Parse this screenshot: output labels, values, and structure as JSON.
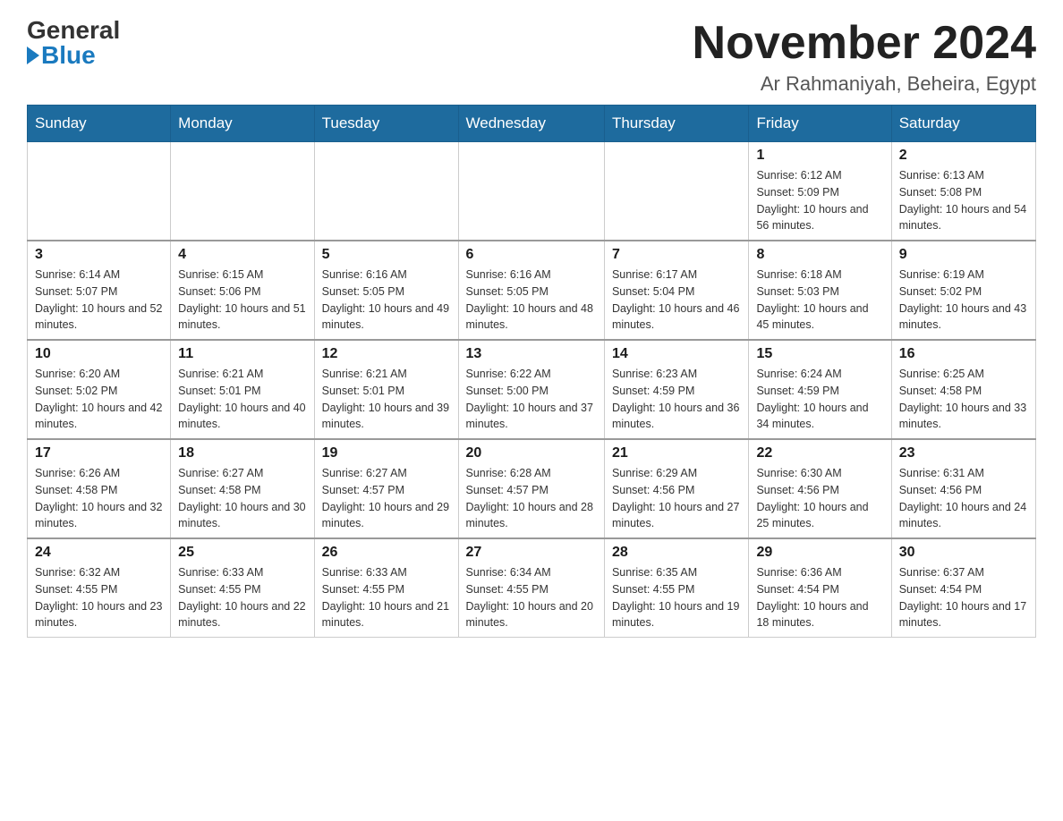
{
  "logo": {
    "general": "General",
    "blue": "Blue"
  },
  "header": {
    "month": "November 2024",
    "location": "Ar Rahmaniyah, Beheira, Egypt"
  },
  "weekdays": [
    "Sunday",
    "Monday",
    "Tuesday",
    "Wednesday",
    "Thursday",
    "Friday",
    "Saturday"
  ],
  "weeks": [
    [
      {
        "day": "",
        "sunrise": "",
        "sunset": "",
        "daylight": ""
      },
      {
        "day": "",
        "sunrise": "",
        "sunset": "",
        "daylight": ""
      },
      {
        "day": "",
        "sunrise": "",
        "sunset": "",
        "daylight": ""
      },
      {
        "day": "",
        "sunrise": "",
        "sunset": "",
        "daylight": ""
      },
      {
        "day": "",
        "sunrise": "",
        "sunset": "",
        "daylight": ""
      },
      {
        "day": "1",
        "sunrise": "Sunrise: 6:12 AM",
        "sunset": "Sunset: 5:09 PM",
        "daylight": "Daylight: 10 hours and 56 minutes."
      },
      {
        "day": "2",
        "sunrise": "Sunrise: 6:13 AM",
        "sunset": "Sunset: 5:08 PM",
        "daylight": "Daylight: 10 hours and 54 minutes."
      }
    ],
    [
      {
        "day": "3",
        "sunrise": "Sunrise: 6:14 AM",
        "sunset": "Sunset: 5:07 PM",
        "daylight": "Daylight: 10 hours and 52 minutes."
      },
      {
        "day": "4",
        "sunrise": "Sunrise: 6:15 AM",
        "sunset": "Sunset: 5:06 PM",
        "daylight": "Daylight: 10 hours and 51 minutes."
      },
      {
        "day": "5",
        "sunrise": "Sunrise: 6:16 AM",
        "sunset": "Sunset: 5:05 PM",
        "daylight": "Daylight: 10 hours and 49 minutes."
      },
      {
        "day": "6",
        "sunrise": "Sunrise: 6:16 AM",
        "sunset": "Sunset: 5:05 PM",
        "daylight": "Daylight: 10 hours and 48 minutes."
      },
      {
        "day": "7",
        "sunrise": "Sunrise: 6:17 AM",
        "sunset": "Sunset: 5:04 PM",
        "daylight": "Daylight: 10 hours and 46 minutes."
      },
      {
        "day": "8",
        "sunrise": "Sunrise: 6:18 AM",
        "sunset": "Sunset: 5:03 PM",
        "daylight": "Daylight: 10 hours and 45 minutes."
      },
      {
        "day": "9",
        "sunrise": "Sunrise: 6:19 AM",
        "sunset": "Sunset: 5:02 PM",
        "daylight": "Daylight: 10 hours and 43 minutes."
      }
    ],
    [
      {
        "day": "10",
        "sunrise": "Sunrise: 6:20 AM",
        "sunset": "Sunset: 5:02 PM",
        "daylight": "Daylight: 10 hours and 42 minutes."
      },
      {
        "day": "11",
        "sunrise": "Sunrise: 6:21 AM",
        "sunset": "Sunset: 5:01 PM",
        "daylight": "Daylight: 10 hours and 40 minutes."
      },
      {
        "day": "12",
        "sunrise": "Sunrise: 6:21 AM",
        "sunset": "Sunset: 5:01 PM",
        "daylight": "Daylight: 10 hours and 39 minutes."
      },
      {
        "day": "13",
        "sunrise": "Sunrise: 6:22 AM",
        "sunset": "Sunset: 5:00 PM",
        "daylight": "Daylight: 10 hours and 37 minutes."
      },
      {
        "day": "14",
        "sunrise": "Sunrise: 6:23 AM",
        "sunset": "Sunset: 4:59 PM",
        "daylight": "Daylight: 10 hours and 36 minutes."
      },
      {
        "day": "15",
        "sunrise": "Sunrise: 6:24 AM",
        "sunset": "Sunset: 4:59 PM",
        "daylight": "Daylight: 10 hours and 34 minutes."
      },
      {
        "day": "16",
        "sunrise": "Sunrise: 6:25 AM",
        "sunset": "Sunset: 4:58 PM",
        "daylight": "Daylight: 10 hours and 33 minutes."
      }
    ],
    [
      {
        "day": "17",
        "sunrise": "Sunrise: 6:26 AM",
        "sunset": "Sunset: 4:58 PM",
        "daylight": "Daylight: 10 hours and 32 minutes."
      },
      {
        "day": "18",
        "sunrise": "Sunrise: 6:27 AM",
        "sunset": "Sunset: 4:58 PM",
        "daylight": "Daylight: 10 hours and 30 minutes."
      },
      {
        "day": "19",
        "sunrise": "Sunrise: 6:27 AM",
        "sunset": "Sunset: 4:57 PM",
        "daylight": "Daylight: 10 hours and 29 minutes."
      },
      {
        "day": "20",
        "sunrise": "Sunrise: 6:28 AM",
        "sunset": "Sunset: 4:57 PM",
        "daylight": "Daylight: 10 hours and 28 minutes."
      },
      {
        "day": "21",
        "sunrise": "Sunrise: 6:29 AM",
        "sunset": "Sunset: 4:56 PM",
        "daylight": "Daylight: 10 hours and 27 minutes."
      },
      {
        "day": "22",
        "sunrise": "Sunrise: 6:30 AM",
        "sunset": "Sunset: 4:56 PM",
        "daylight": "Daylight: 10 hours and 25 minutes."
      },
      {
        "day": "23",
        "sunrise": "Sunrise: 6:31 AM",
        "sunset": "Sunset: 4:56 PM",
        "daylight": "Daylight: 10 hours and 24 minutes."
      }
    ],
    [
      {
        "day": "24",
        "sunrise": "Sunrise: 6:32 AM",
        "sunset": "Sunset: 4:55 PM",
        "daylight": "Daylight: 10 hours and 23 minutes."
      },
      {
        "day": "25",
        "sunrise": "Sunrise: 6:33 AM",
        "sunset": "Sunset: 4:55 PM",
        "daylight": "Daylight: 10 hours and 22 minutes."
      },
      {
        "day": "26",
        "sunrise": "Sunrise: 6:33 AM",
        "sunset": "Sunset: 4:55 PM",
        "daylight": "Daylight: 10 hours and 21 minutes."
      },
      {
        "day": "27",
        "sunrise": "Sunrise: 6:34 AM",
        "sunset": "Sunset: 4:55 PM",
        "daylight": "Daylight: 10 hours and 20 minutes."
      },
      {
        "day": "28",
        "sunrise": "Sunrise: 6:35 AM",
        "sunset": "Sunset: 4:55 PM",
        "daylight": "Daylight: 10 hours and 19 minutes."
      },
      {
        "day": "29",
        "sunrise": "Sunrise: 6:36 AM",
        "sunset": "Sunset: 4:54 PM",
        "daylight": "Daylight: 10 hours and 18 minutes."
      },
      {
        "day": "30",
        "sunrise": "Sunrise: 6:37 AM",
        "sunset": "Sunset: 4:54 PM",
        "daylight": "Daylight: 10 hours and 17 minutes."
      }
    ]
  ]
}
